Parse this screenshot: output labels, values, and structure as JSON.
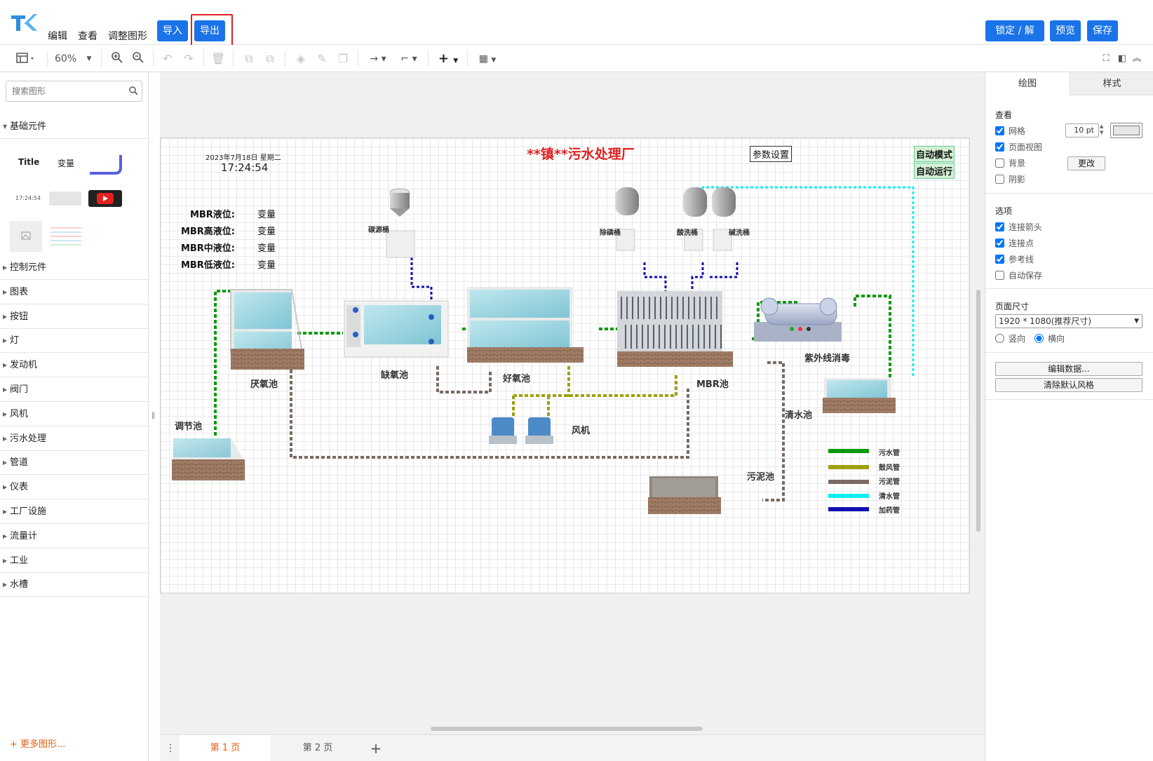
{
  "header": {
    "menus": [
      "编辑",
      "查看",
      "调整图形"
    ],
    "import_label": "导入",
    "export_label": "导出",
    "lock_label": "锁定 / 解锁",
    "preview_label": "预览",
    "save_label": "保存"
  },
  "toolbar": {
    "zoom": "60%"
  },
  "sidebar": {
    "search_placeholder": "搜索图形",
    "open_category": "基础元件",
    "basic_shapes": {
      "title": "Title",
      "variable": "变量",
      "clock_time": "17:24:54"
    },
    "categories": [
      "控制元件",
      "图表",
      "按钮",
      "灯",
      "发动机",
      "阀门",
      "风机",
      "污水处理",
      "管道",
      "仪表",
      "工厂设施",
      "流量计",
      "工业",
      "水槽"
    ],
    "more_shapes": "+ 更多图形..."
  },
  "diagram": {
    "title": "**镇**污水处理厂",
    "date": "2023年7月18日 星期二",
    "time": "17:24:54",
    "param_button": "参数设置",
    "auto_mode": "自动模式",
    "auto_run": "自动运行",
    "levels": [
      {
        "label": "MBR液位:",
        "value": "变量"
      },
      {
        "label": "MBR高液位:",
        "value": "变量"
      },
      {
        "label": "MBR中液位:",
        "value": "变量"
      },
      {
        "label": "MBR低液位:",
        "value": "变量"
      }
    ],
    "units": {
      "tiaojie": "调节池",
      "yanyang": "厌氧池",
      "queyang": "缺氧池",
      "haoyang": "好氧池",
      "mbr": "MBR池",
      "ziwai": "紫外线消毒",
      "qingshui": "清水池",
      "wuni": "污泥池",
      "fengji": "风机",
      "tanyuan": "碳源桶",
      "chulin": "除磷桶",
      "suanxi": "酸洗桶",
      "jianxi": "碱洗桶"
    },
    "legend": [
      {
        "label": "污水管",
        "color": "#0a9a0a"
      },
      {
        "label": "鼓风管",
        "color": "#a0a010"
      },
      {
        "label": "污泥管",
        "color": "#7a6a62"
      },
      {
        "label": "清水管",
        "color": "#10f0f0"
      },
      {
        "label": "加药管",
        "color": "#1010b0"
      }
    ]
  },
  "pages": {
    "tabs": [
      "第 1 页",
      "第 2 页"
    ]
  },
  "rpanel": {
    "tabs": [
      "绘图",
      "样式"
    ],
    "view_section": "查看",
    "grid_label": "网格",
    "grid_size": "10 pt",
    "page_view_label": "页面视图",
    "background_label": "背景",
    "change_label": "更改",
    "shadow_label": "阴影",
    "options_section": "选项",
    "connect_arrows": "连接箭头",
    "connect_points": "连接点",
    "guides": "参考线",
    "autosave": "自动保存",
    "page_size_section": "页面尺寸",
    "page_size": "1920 * 1080(推荐尺寸)",
    "portrait": "竖向",
    "landscape": "横向",
    "edit_data": "编辑数据...",
    "clear_style": "清除默认风格"
  }
}
